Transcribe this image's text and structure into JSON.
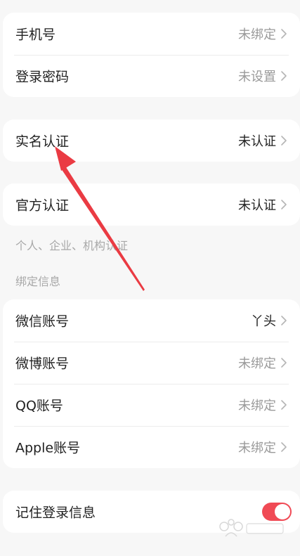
{
  "group1": {
    "phone": {
      "label": "手机号",
      "value": "未绑定"
    },
    "password": {
      "label": "登录密码",
      "value": "未设置"
    }
  },
  "realname": {
    "label": "实名认证",
    "value": "未认证"
  },
  "official": {
    "label": "官方认证",
    "value": "未认证",
    "note": "个人、企业、机构认证"
  },
  "binding": {
    "title": "绑定信息",
    "wechat": {
      "label": "微信账号",
      "value": "丫头"
    },
    "weibo": {
      "label": "微博账号",
      "value": "未绑定"
    },
    "qq": {
      "label": "QQ账号",
      "value": "未绑定"
    },
    "apple": {
      "label": "Apple账号",
      "value": "未绑定"
    }
  },
  "remember": {
    "label": "记住登录信息",
    "enabled": true
  },
  "colors": {
    "accent": "#f04a55",
    "annotation_arrow": "#ea3b43",
    "background": "#f7f7f7",
    "muted_text": "#9a9a9a"
  }
}
